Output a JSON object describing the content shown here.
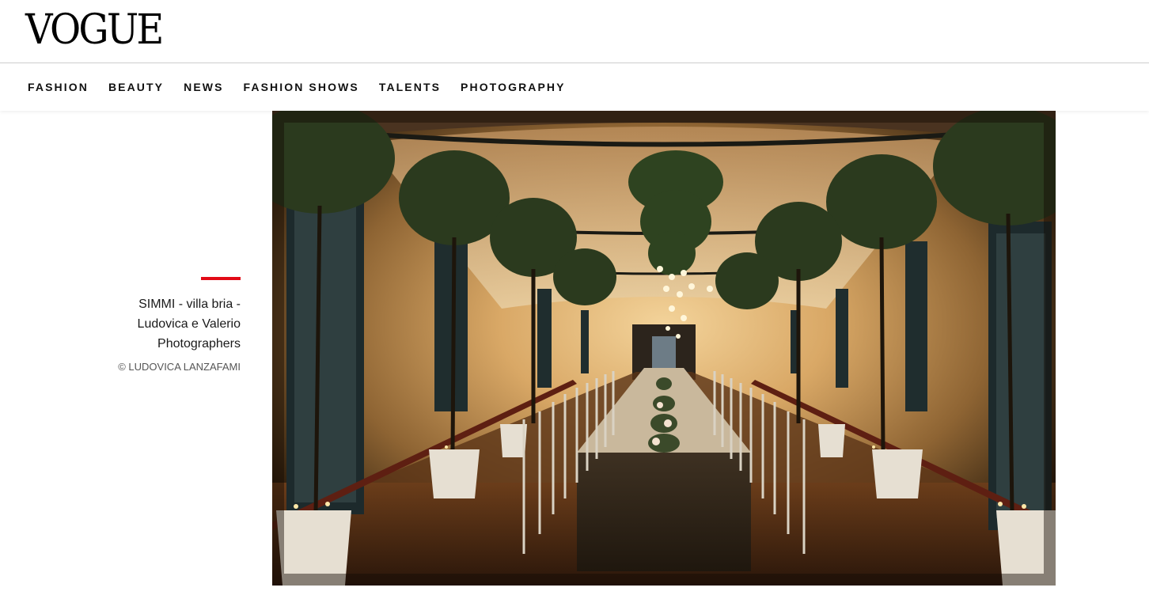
{
  "header": {
    "logo_text": "VOGUE"
  },
  "nav": {
    "items": [
      {
        "label": "FASHION"
      },
      {
        "label": "BEAUTY"
      },
      {
        "label": "NEWS"
      },
      {
        "label": "FASHION SHOWS"
      },
      {
        "label": "TALENTS"
      },
      {
        "label": "PHOTOGRAPHY"
      }
    ]
  },
  "caption": {
    "title_line1": "SIMMI - villa bria -",
    "title_line2": "Ludovica e Valerio",
    "title_line3": "Photographers",
    "credit": "© LUDOVICA LANZAFAMI",
    "accent_color": "#e20a16"
  }
}
